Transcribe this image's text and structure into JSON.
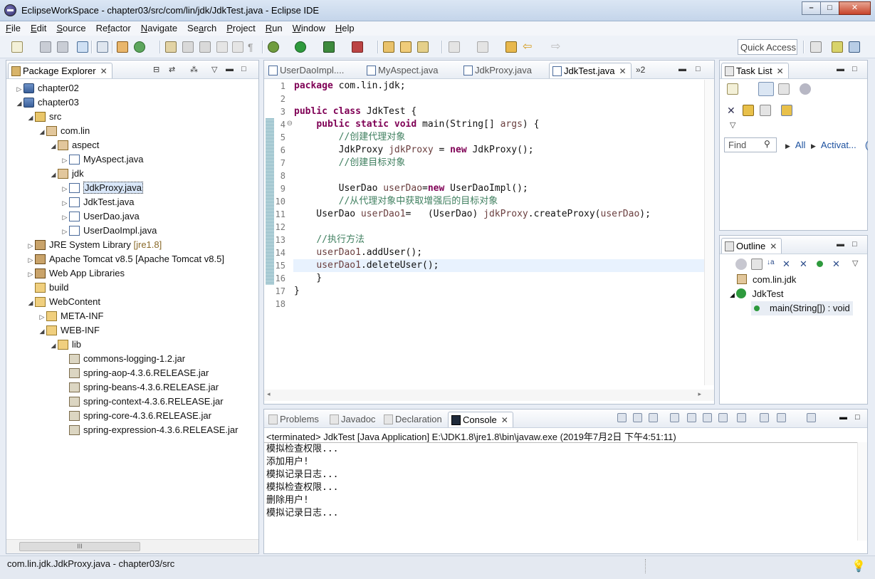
{
  "window": {
    "title": "EclipseWorkSpace - chapter03/src/com/lin/jdk/JdkTest.java - Eclipse IDE",
    "minimize": "–",
    "maximize": "□",
    "close": "✕"
  },
  "menu": [
    "File",
    "Edit",
    "Source",
    "Refactor",
    "Navigate",
    "Search",
    "Project",
    "Run",
    "Window",
    "Help"
  ],
  "menu_mnemonics": [
    "F",
    "E",
    "S",
    "f",
    "N",
    "a",
    "P",
    "R",
    "W",
    "H"
  ],
  "toolbar": {
    "quick_access": "Quick Access"
  },
  "package_explorer": {
    "tab": "Package Explorer",
    "items": [
      {
        "label": "chapter02",
        "type": "project",
        "depth": 0,
        "arrow": "▷"
      },
      {
        "label": "chapter03",
        "type": "project",
        "depth": 0,
        "arrow": "◢"
      },
      {
        "label": "src",
        "type": "srcfolder",
        "depth": 1,
        "arrow": "◢"
      },
      {
        "label": "com.lin",
        "type": "package",
        "depth": 2,
        "arrow": "◢"
      },
      {
        "label": "aspect",
        "type": "package",
        "depth": 3,
        "arrow": "◢"
      },
      {
        "label": "MyAspect.java",
        "type": "java",
        "depth": 4,
        "arrow": "▷"
      },
      {
        "label": "jdk",
        "type": "package",
        "depth": 3,
        "arrow": "◢"
      },
      {
        "label": "JdkProxy.java",
        "type": "java",
        "depth": 4,
        "arrow": "▷",
        "selected": true
      },
      {
        "label": "JdkTest.java",
        "type": "java",
        "depth": 4,
        "arrow": "▷"
      },
      {
        "label": "UserDao.java",
        "type": "java",
        "depth": 4,
        "arrow": "▷"
      },
      {
        "label": "UserDaoImpl.java",
        "type": "java",
        "depth": 4,
        "arrow": "▷"
      },
      {
        "label": "JRE System Library",
        "suffix": "[jre1.8]",
        "type": "library",
        "depth": 1,
        "arrow": "▷"
      },
      {
        "label": "Apache Tomcat v8.5 [Apache Tomcat v8.5]",
        "type": "library",
        "depth": 1,
        "arrow": "▷"
      },
      {
        "label": "Web App Libraries",
        "type": "library",
        "depth": 1,
        "arrow": "▷"
      },
      {
        "label": "build",
        "type": "folder",
        "depth": 1,
        "arrow": ""
      },
      {
        "label": "WebContent",
        "type": "folder",
        "depth": 1,
        "arrow": "◢"
      },
      {
        "label": "META-INF",
        "type": "folder",
        "depth": 2,
        "arrow": "▷"
      },
      {
        "label": "WEB-INF",
        "type": "folder",
        "depth": 2,
        "arrow": "◢"
      },
      {
        "label": "lib",
        "type": "folder",
        "depth": 3,
        "arrow": "◢"
      },
      {
        "label": "commons-logging-1.2.jar",
        "type": "jar",
        "depth": 4,
        "arrow": ""
      },
      {
        "label": "spring-aop-4.3.6.RELEASE.jar",
        "type": "jar",
        "depth": 4,
        "arrow": ""
      },
      {
        "label": "spring-beans-4.3.6.RELEASE.jar",
        "type": "jar",
        "depth": 4,
        "arrow": ""
      },
      {
        "label": "spring-context-4.3.6.RELEASE.jar",
        "type": "jar",
        "depth": 4,
        "arrow": ""
      },
      {
        "label": "spring-core-4.3.6.RELEASE.jar",
        "type": "jar",
        "depth": 4,
        "arrow": ""
      },
      {
        "label": "spring-expression-4.3.6.RELEASE.jar",
        "type": "jar",
        "depth": 4,
        "arrow": ""
      }
    ],
    "scroll_thumb": "III"
  },
  "editor": {
    "tabs": [
      {
        "label": "UserDaoImpl....",
        "active": false
      },
      {
        "label": "MyAspect.java",
        "active": false
      },
      {
        "label": "JdkProxy.java",
        "active": false
      },
      {
        "label": "JdkTest.java",
        "active": true
      }
    ],
    "overflow": "»2",
    "lines": [
      [
        [
          "kw",
          "package"
        ],
        [
          "",
          " com.lin.jdk;"
        ]
      ],
      [],
      [
        [
          "kw",
          "public class"
        ],
        [
          "",
          " JdkTest {"
        ]
      ],
      [
        [
          "",
          "    "
        ],
        [
          "kw",
          "public static void"
        ],
        [
          "",
          " main(String[] "
        ],
        [
          "var",
          "args"
        ],
        [
          "",
          ") {"
        ]
      ],
      [
        [
          "",
          "        "
        ],
        [
          "cm",
          "//创建代理对象"
        ]
      ],
      [
        [
          "",
          "        JdkProxy "
        ],
        [
          "var",
          "jdkProxy"
        ],
        [
          "",
          " = "
        ],
        [
          "kw",
          "new"
        ],
        [
          "",
          " JdkProxy();"
        ]
      ],
      [
        [
          "",
          "        "
        ],
        [
          "cm",
          "//创建目标对象"
        ]
      ],
      [],
      [
        [
          "",
          "        UserDao "
        ],
        [
          "var",
          "userDao"
        ],
        [
          "",
          "="
        ],
        [
          "kw",
          "new"
        ],
        [
          "",
          " UserDaoImpl();"
        ]
      ],
      [
        [
          "",
          "        "
        ],
        [
          "cm",
          "//从代理对象中获取增强后的目标对象"
        ]
      ],
      [
        [
          "",
          "    UserDao "
        ],
        [
          "var",
          "userDao1"
        ],
        [
          "",
          "=   (UserDao) "
        ],
        [
          "var",
          "jdkProxy"
        ],
        [
          "",
          ".createProxy("
        ],
        [
          "var",
          "userDao"
        ],
        [
          "",
          ");"
        ]
      ],
      [],
      [
        [
          "",
          "    "
        ],
        [
          "cm",
          "//执行方法"
        ]
      ],
      [
        [
          "",
          "    "
        ],
        [
          "var",
          "userDao1"
        ],
        [
          "",
          ".addUser();"
        ]
      ],
      [
        [
          "",
          "    "
        ],
        [
          "var",
          "userDao1"
        ],
        [
          "",
          ".deleteUser();"
        ]
      ],
      [
        [
          "",
          "    }"
        ]
      ],
      [
        [
          "",
          "}"
        ]
      ],
      []
    ],
    "highlight_line": 15,
    "fold_marker_line": 4
  },
  "task_list": {
    "tab": "Task List",
    "find_placeholder": "Find",
    "all": "All",
    "activate": "Activat...",
    "paren": "("
  },
  "outline": {
    "tab": "Outline",
    "items": [
      {
        "label": "com.lin.jdk",
        "type": "package"
      },
      {
        "label": "JdkTest",
        "type": "class"
      },
      {
        "label": "main(String[]) : void",
        "type": "method"
      }
    ]
  },
  "bottom": {
    "tabs": [
      "Problems",
      "Javadoc",
      "Declaration",
      "Console"
    ],
    "active": "Console",
    "status": "<terminated> JdkTest [Java Application] E:\\JDK1.8\\jre1.8\\bin\\javaw.exe (2019年7月2日 下午4:51:11)",
    "output": [
      "模拟检查权限...",
      "添加用户!",
      "模拟记录日志...",
      "模拟检查权限...",
      "删除用户!",
      "模拟记录日志..."
    ]
  },
  "statusbar": {
    "text": "com.lin.jdk.JdkProxy.java - chapter03/src"
  },
  "colors": {
    "keyword": "#7f0055",
    "comment": "#3f7f5f",
    "variable": "#6a3e3e",
    "selection": "#d9e7f9",
    "current_line": "#e8f2fe"
  }
}
